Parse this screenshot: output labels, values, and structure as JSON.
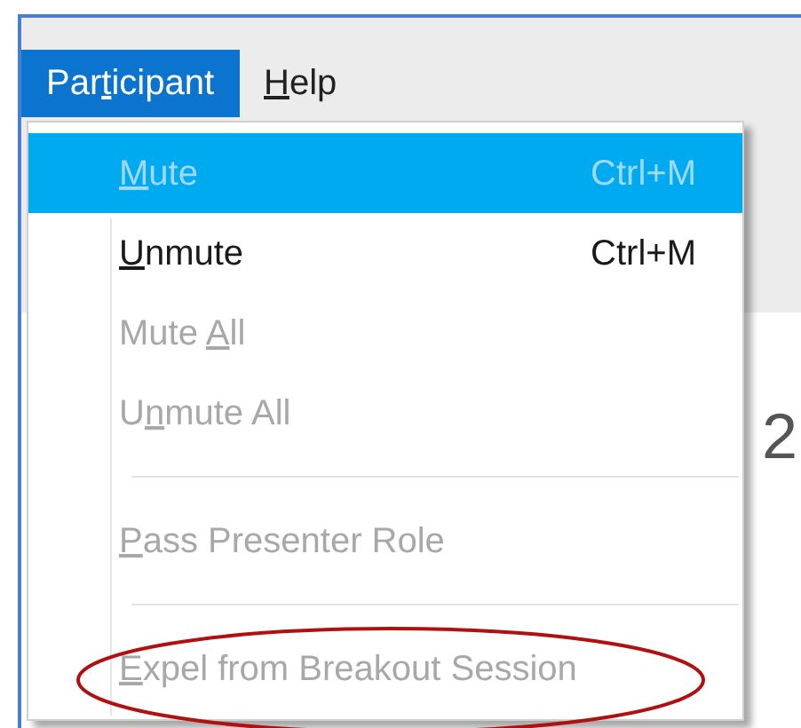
{
  "menu_bar": [
    {
      "pre": "Par",
      "key": "t",
      "post": "icipant",
      "selected": true
    },
    {
      "key": "H",
      "post": "elp",
      "selected": false
    }
  ],
  "menu": {
    "items": [
      {
        "kind": "item",
        "key": "M",
        "post": "ute",
        "shortcut": "Ctrl+M",
        "disabled": true,
        "selected": true,
        "circled": false
      },
      {
        "kind": "item",
        "key": "U",
        "post": "nmute",
        "shortcut": "Ctrl+M",
        "disabled": false,
        "selected": false,
        "circled": false
      },
      {
        "kind": "item",
        "pre": "Mute ",
        "key": "A",
        "post": "ll",
        "disabled": true,
        "selected": false,
        "circled": false
      },
      {
        "kind": "item",
        "pre": "U",
        "key": "n",
        "post": "mute All",
        "disabled": true,
        "selected": false,
        "circled": false
      },
      {
        "kind": "separator"
      },
      {
        "kind": "item",
        "key": "P",
        "post": "ass Presenter Role",
        "disabled": true,
        "selected": false,
        "circled": false
      },
      {
        "kind": "separator"
      },
      {
        "kind": "item",
        "key": "E",
        "post": "xpel from Breakout Session",
        "disabled": true,
        "selected": false,
        "circled": true
      }
    ]
  },
  "content_text": "2"
}
